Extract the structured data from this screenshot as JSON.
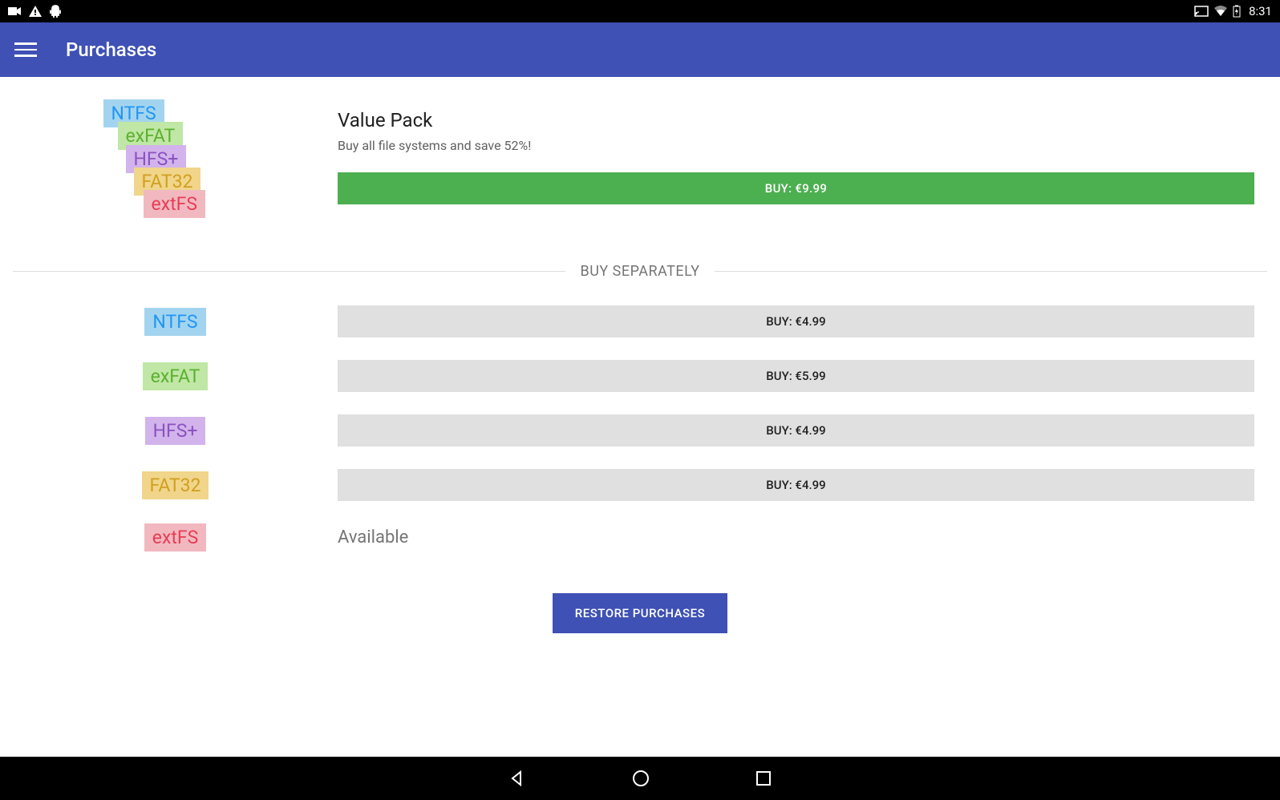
{
  "status_bar": {
    "time": "8:31"
  },
  "app_bar": {
    "title": "Purchases"
  },
  "value_pack": {
    "title": "Value Pack",
    "subtitle": "Buy all file systems and save 52%!",
    "buy_label": "BUY: €9.99",
    "fs_labels": [
      "NTFS",
      "exFAT",
      "HFS+",
      "FAT32",
      "extFS"
    ]
  },
  "separator": {
    "label": "BUY SEPARATELY"
  },
  "items": [
    {
      "name": "NTFS",
      "buy_label": "BUY: €4.99",
      "available": false
    },
    {
      "name": "exFAT",
      "buy_label": "BUY: €5.99",
      "available": false
    },
    {
      "name": "HFS+",
      "buy_label": "BUY: €4.99",
      "available": false
    },
    {
      "name": "FAT32",
      "buy_label": "BUY: €4.99",
      "available": false
    },
    {
      "name": "extFS",
      "available_label": "Available",
      "available": true
    }
  ],
  "restore": {
    "label": "RESTORE PURCHASES"
  }
}
